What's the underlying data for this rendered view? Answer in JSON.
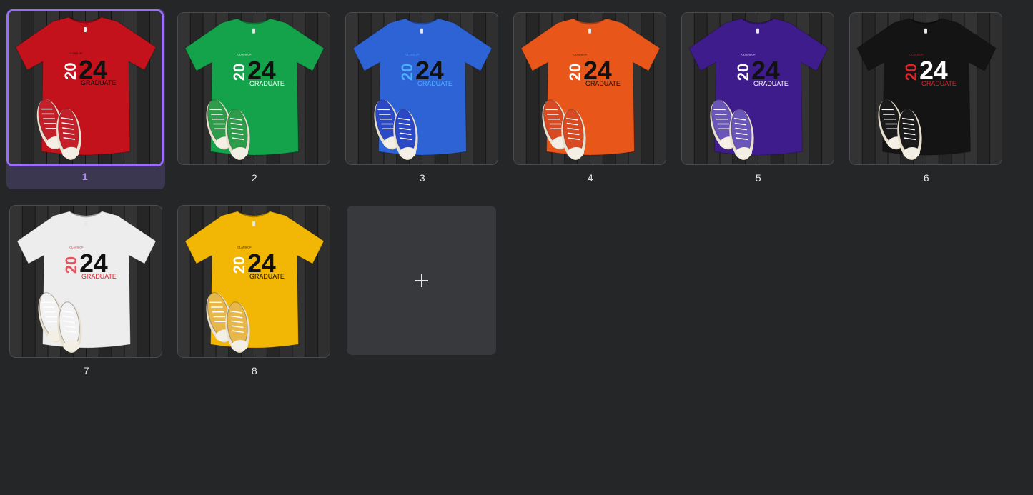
{
  "pages": [
    {
      "label": "1",
      "selected": true,
      "shirt_color": "#c3121c",
      "numeral_color": "#ffffff",
      "accent_color": "#111111",
      "shoe_color": "#c51f2a"
    },
    {
      "label": "2",
      "selected": false,
      "shirt_color": "#14a34a",
      "numeral_color": "#ffffff",
      "accent_color": "#ffffff",
      "shoe_color": "#2e9d4a"
    },
    {
      "label": "3",
      "selected": false,
      "shirt_color": "#2d63d4",
      "numeral_color": "#4fb0ff",
      "accent_color": "#4fb0ff",
      "shoe_color": "#2b49c6"
    },
    {
      "label": "4",
      "selected": false,
      "shirt_color": "#e8561a",
      "numeral_color": "#ffffff",
      "accent_color": "#111111",
      "shoe_color": "#d94a22"
    },
    {
      "label": "5",
      "selected": false,
      "shirt_color": "#3f1c8c",
      "numeral_color": "#ffffff",
      "accent_color": "#ffffff",
      "shoe_color": "#6a55b8"
    },
    {
      "label": "6",
      "selected": false,
      "shirt_color": "#141414",
      "numeral_color": "#e0242c",
      "accent_color": "#e0242c",
      "shoe_color": "#1b1b1b"
    },
    {
      "label": "7",
      "selected": false,
      "shirt_color": "#ededed",
      "numeral_color": "#e8505a",
      "accent_color": "#e0242c",
      "shoe_color": "#f2f2f2"
    },
    {
      "label": "8",
      "selected": false,
      "shirt_color": "#f2b705",
      "numeral_color": "#ffffff",
      "accent_color": "#111111",
      "shoe_color": "#e7b74a"
    }
  ],
  "shirt_design": {
    "top_text": "CLASS OF",
    "year_left": "20",
    "year_right": "24",
    "bottom_text": "GRADUATE"
  },
  "add_page": {
    "icon": "plus-icon"
  }
}
